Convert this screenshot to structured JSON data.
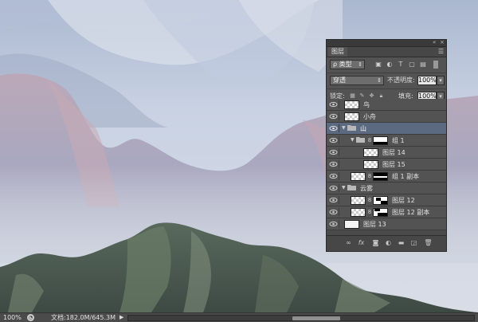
{
  "status_bar": {
    "zoom": "100%",
    "doc_info": "文档:182.0M/645.3M",
    "scroll_position": 0.55
  },
  "layers_panel": {
    "tab_label": "图层",
    "filter": {
      "label": "ρ 类型"
    },
    "blend_mode": "穿透",
    "opacity_label": "不透明度:",
    "opacity_value": "100%",
    "lock_label": "锁定:",
    "fill_label": "填充:",
    "fill_value": "100%",
    "layers": [
      {
        "name": "鸟",
        "type": "layer",
        "thumb": "checker",
        "visible": true
      },
      {
        "name": "小舟",
        "type": "layer",
        "thumb": "checker",
        "visible": true
      },
      {
        "name": "山",
        "type": "group",
        "expanded": true,
        "selected": true,
        "visible": true
      },
      {
        "name": "组 1",
        "type": "group",
        "expanded": true,
        "mask": true,
        "visible": true
      },
      {
        "name": "图层 14",
        "type": "layer",
        "thumb": "checker",
        "visible": true
      },
      {
        "name": "图层 15",
        "type": "layer",
        "thumb": "checker",
        "visible": true
      },
      {
        "name": "组 1 副本",
        "type": "layer",
        "thumb": "checker",
        "mask": true,
        "visible": true
      },
      {
        "name": "云雾",
        "type": "group",
        "expanded": true,
        "visible": true
      },
      {
        "name": "图层 12",
        "type": "layer",
        "thumb": "checker",
        "mask": true,
        "visible": true
      },
      {
        "name": "图层 12 副本",
        "type": "layer",
        "thumb": "checker",
        "mask": true,
        "visible": true
      },
      {
        "name": "图层 13",
        "type": "layer",
        "thumb": "white",
        "visible": true
      }
    ]
  },
  "colors": {
    "panel_bg": "#535353",
    "selected_row": "#5b6a80",
    "statusbar_bg": "#4b4b4b"
  }
}
